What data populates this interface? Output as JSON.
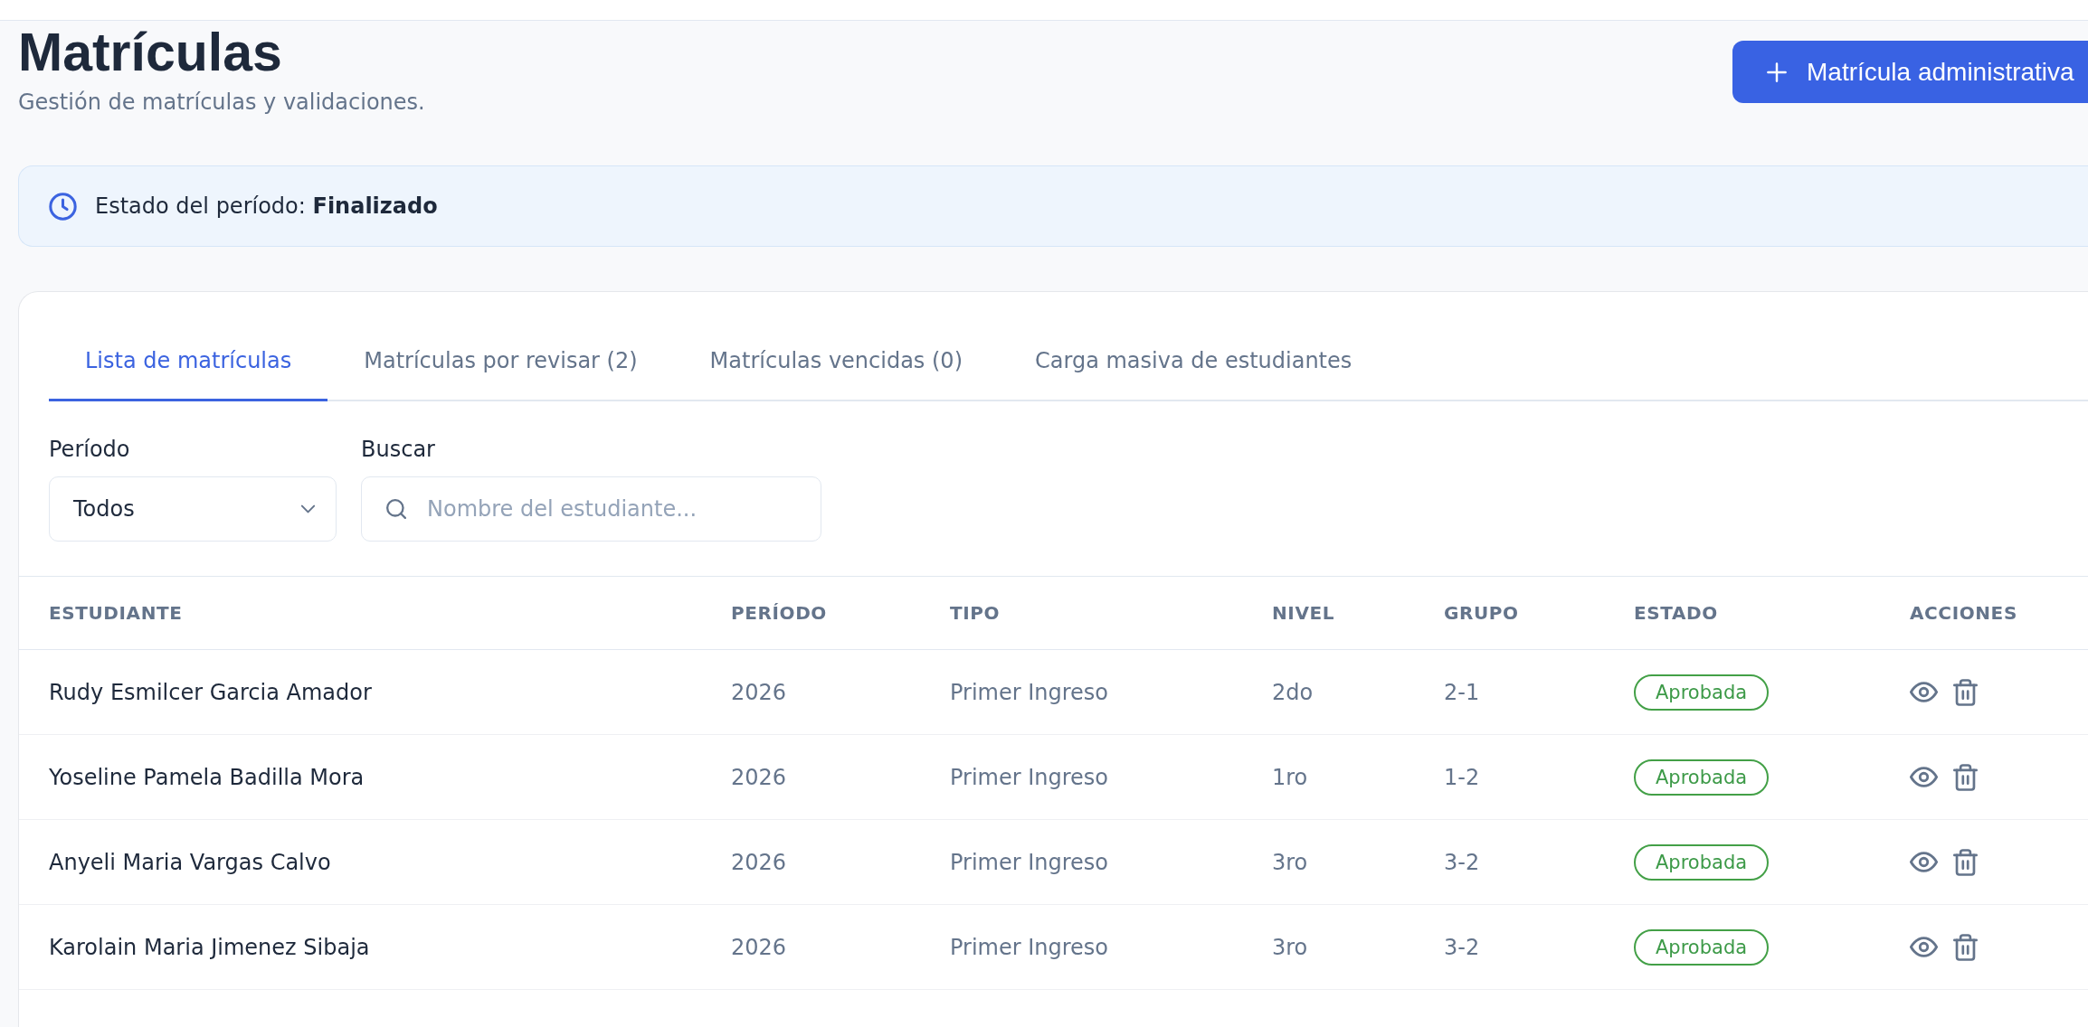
{
  "page": {
    "title": "Matrículas",
    "subtitle": "Gestión de matrículas y validaciones."
  },
  "primary_button": {
    "label": "Matrícula administrativa"
  },
  "period_banner": {
    "text": "Estado del período: **Finalizado**"
  },
  "tabs": [
    {
      "label": "Lista de matrículas",
      "selected": true
    },
    {
      "label": "Matrículas por revisar (2)",
      "selected": false
    },
    {
      "label": "Matrículas vencidas (0)",
      "selected": false
    },
    {
      "label": "Carga masiva de estudiantes",
      "selected": false
    }
  ],
  "filters": {
    "period": {
      "label": "Período",
      "value": "Todos"
    },
    "search": {
      "label": "Buscar",
      "placeholder": "Nombre del estudiante..."
    }
  },
  "table": {
    "columns": [
      "ESTUDIANTE",
      "PERÍODO",
      "TIPO",
      "NIVEL",
      "GRUPO",
      "ESTADO",
      "ACCIONES"
    ],
    "rows": [
      {
        "student": "Rudy Esmilcer Garcia Amador",
        "period": "2026",
        "type": "Primer Ingreso",
        "level": "2do",
        "group": "2-1",
        "status": "Aprobada"
      },
      {
        "student": "Yoseline Pamela Badilla Mora",
        "period": "2026",
        "type": "Primer Ingreso",
        "level": "1ro",
        "group": "1-2",
        "status": "Aprobada"
      },
      {
        "student": "Anyeli Maria Vargas Calvo",
        "period": "2026",
        "type": "Primer Ingreso",
        "level": "3ro",
        "group": "3-2",
        "status": "Aprobada"
      },
      {
        "student": "Karolain Maria Jimenez Sibaja",
        "period": "2026",
        "type": "Primer Ingreso",
        "level": "3ro",
        "group": "3-2",
        "status": "Aprobada"
      }
    ]
  }
}
